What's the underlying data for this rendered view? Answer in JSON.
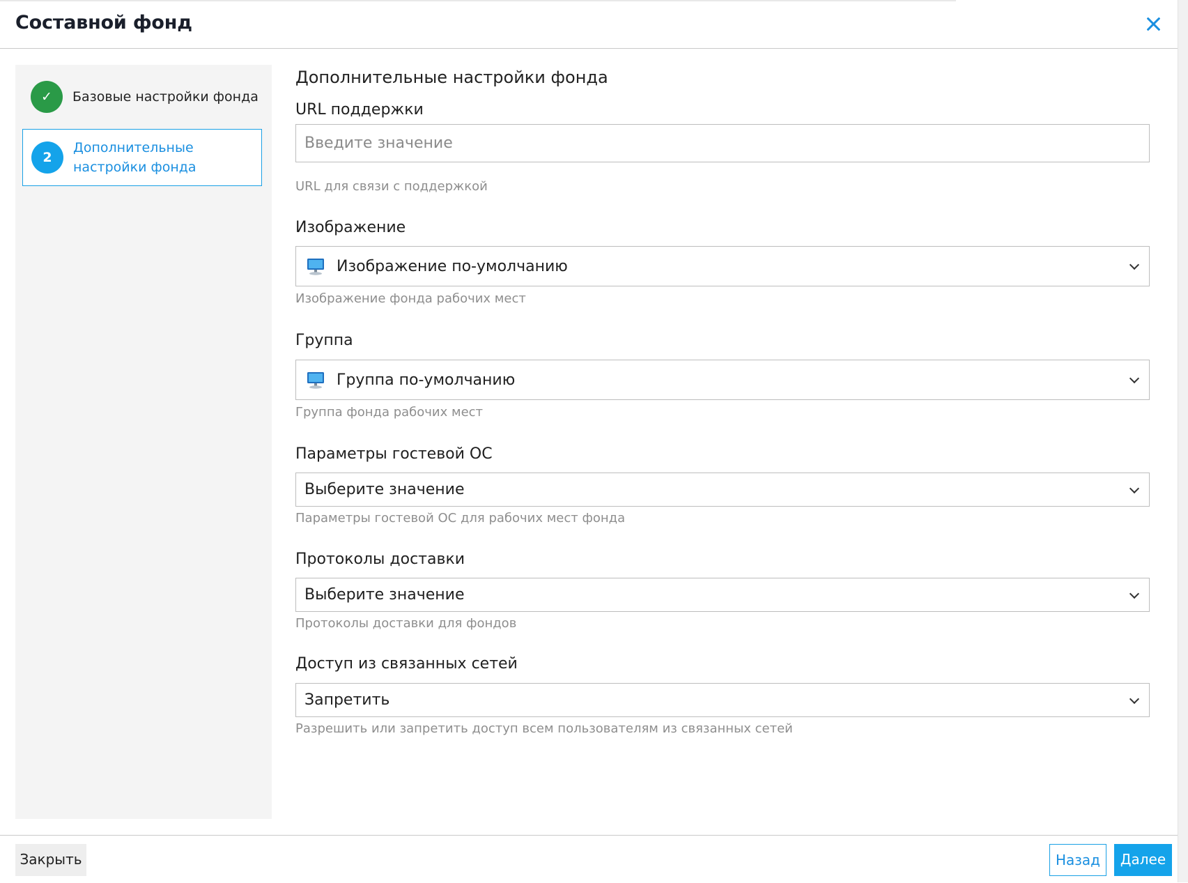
{
  "dialog": {
    "title": "Составной фонд"
  },
  "steps": [
    {
      "marker": "✓",
      "label": "Базовые настройки фонда",
      "state": "completed"
    },
    {
      "marker": "2",
      "label": "Дополнительные настройки фонда",
      "state": "active"
    }
  ],
  "form": {
    "section_title": "Дополнительные настройки фонда",
    "support_url": {
      "label": "URL поддержки",
      "placeholder": "Введите значение",
      "value": "",
      "hint": "URL для связи с поддержкой"
    },
    "image": {
      "label": "Изображение",
      "value": "Изображение по-умолчанию",
      "icon": "monitor-icon",
      "hint": "Изображение фонда рабочих мест"
    },
    "group": {
      "label": "Группа",
      "value": "Группа по-умолчанию",
      "icon": "monitor-icon",
      "hint": "Группа фонда рабочих мест"
    },
    "guest_os": {
      "label": "Параметры гостевой ОС",
      "value": "Выберите значение",
      "hint": "Параметры гостевой ОС для рабочих мест фонда"
    },
    "protocols": {
      "label": "Протоколы доставки",
      "value": "Выберите значение",
      "hint": "Протоколы доставки для фондов"
    },
    "linked_networks": {
      "label": "Доступ из связанных сетей",
      "value": "Запретить",
      "hint": "Разрешить или запретить доступ всем пользователям из связанных сетей"
    }
  },
  "footer": {
    "close_label": "Закрыть",
    "back_label": "Назад",
    "next_label": "Далее"
  },
  "colors": {
    "accent": "#14a3ea",
    "success": "#2a9a47",
    "hint": "#8e8e8e"
  }
}
